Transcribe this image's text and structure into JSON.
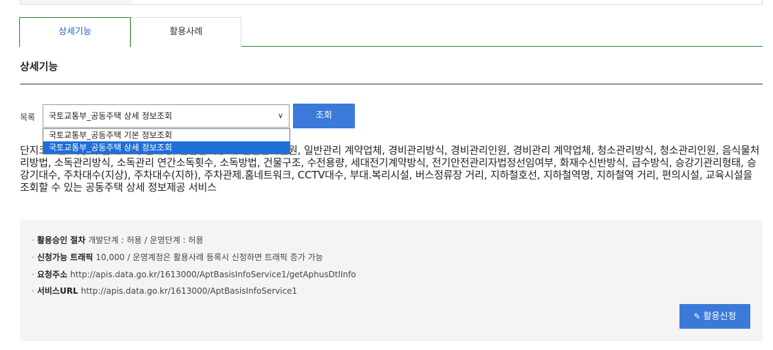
{
  "tabs": [
    {
      "label": "상세기능"
    },
    {
      "label": "활용사례"
    }
  ],
  "section_title": "상세기능",
  "list": {
    "label": "목록",
    "selected": "국토교통부_공동주택 상세 정보조회",
    "options": [
      "국토교통부_공동주택 기본 정보조회",
      "국토교통부_공동주택 상세 정보조회"
    ],
    "search_label": "조회"
  },
  "description": "단지코드를 이용해 단지코드, 단지명, 일반관리방식, 일반관리인원, 일반관리 계약업체, 경비관리방식, 경비관리인원, 경비관리 계약업체, 청소관리방식, 청소관리인원, 음식물처리방법, 소독관리방식, 소독관리 연간소독횟수, 소독방법, 건물구조, 수전용량, 세대전기계약방식, 전기안전관리자법정선임여부, 화재수신반방식, 급수방식, 승강기관리형태, 승강기대수, 주차대수(지상), 주차대수(지하), 주차관제.홈네트워크, CCTV대수, 부대.복리시설, 버스정류장 거리, 지하철호선, 지하철역명, 지하철역 거리, 편의시설, 교육시설을 조회할 수 있는 공동주택 상세 정보제공 서비스",
  "info": {
    "approval": {
      "label": "활용승인 절차",
      "value": "개발단계 : 허용 / 운영단계 : 허용"
    },
    "traffic": {
      "label": "신청가능 트래픽",
      "value": "10,000 / 운영계정은 활용사례 등록시 신청하면 트래픽 증가 가능"
    },
    "request_url": {
      "label": "요청주소",
      "value": "http://apis.data.go.kr/1613000/AptBasisInfoService1/getAphusDtlInfo"
    },
    "service_url": {
      "label": "서비스URL",
      "value": "http://apis.data.go.kr/1613000/AptBasisInfoService1"
    },
    "bullet": "·",
    "apply_label": "활용신청"
  },
  "icons": {
    "select_arrow": "chevron-down-icon",
    "apply": "pencil-icon"
  }
}
